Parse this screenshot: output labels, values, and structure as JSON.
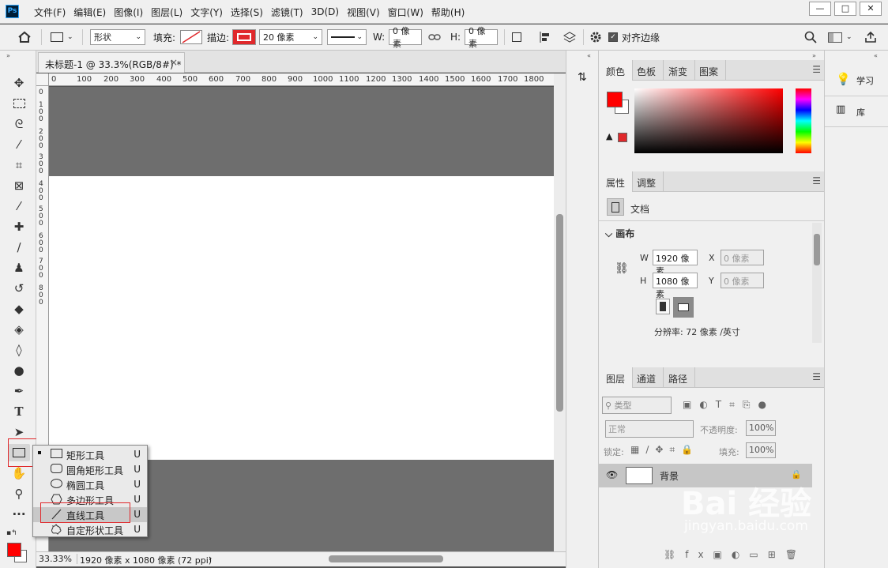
{
  "app": {
    "logo": "Ps"
  },
  "menu": [
    "文件(F)",
    "编辑(E)",
    "图像(I)",
    "图层(L)",
    "文字(Y)",
    "选择(S)",
    "滤镜(T)",
    "3D(D)",
    "视图(V)",
    "窗口(W)",
    "帮助(H)"
  ],
  "window_buttons": [
    "—",
    "□",
    "✕"
  ],
  "options": {
    "mode": "形状",
    "fill_label": "填充:",
    "stroke_label": "描边:",
    "stroke_width": "20 像素",
    "w_label": "W:",
    "w_value": "0 像素",
    "h_label": "H:",
    "h_value": "0 像素",
    "align_edges": "对齐边缘"
  },
  "document": {
    "tab_title": "未标题-1 @ 33.3%(RGB/8#) *",
    "close": "×",
    "ruler_h": [
      "0",
      "100",
      "200",
      "300",
      "400",
      "500",
      "600",
      "700",
      "800",
      "900",
      "1000",
      "1100",
      "1200",
      "1300",
      "1400",
      "1500",
      "1600",
      "1700",
      "1800"
    ],
    "ruler_v": [
      "0",
      "1\n0\n0",
      "2\n0\n0",
      "3\n0\n0",
      "4\n0\n0",
      "5\n0\n0",
      "6\n0\n0",
      "7\n0\n0",
      "8\n0\n0"
    ],
    "zoom": "33.33%",
    "doc_info": "1920 像素 x 1080 像素 (72 ppi)",
    "status_arrow": "›"
  },
  "flyout": [
    {
      "label": "矩形工具",
      "key": "U"
    },
    {
      "label": "圆角矩形工具",
      "key": "U"
    },
    {
      "label": "椭圆工具",
      "key": "U"
    },
    {
      "label": "多边形工具",
      "key": "U"
    },
    {
      "label": "直线工具",
      "key": "U"
    },
    {
      "label": "自定形状工具",
      "key": "U"
    }
  ],
  "color_panel": {
    "tabs": [
      "颜色",
      "色板",
      "渐变",
      "图案"
    ],
    "foreground": "#ff0000",
    "background": "#ffffff"
  },
  "properties_panel": {
    "tabs": [
      "属性",
      "调整"
    ],
    "doc_label": "文档",
    "section": "画布",
    "w_label": "W",
    "w_value": "1920 像素",
    "h_label": "H",
    "h_value": "1080 像素",
    "x_label": "X",
    "x_value": "0 像素",
    "y_label": "Y",
    "y_value": "0 像素",
    "resolution": "分辨率: 72 像素 /英寸"
  },
  "layers_panel": {
    "tabs": [
      "图层",
      "通道",
      "路径"
    ],
    "filter": "类型",
    "blend_mode": "正常",
    "opacity_label": "不透明度:",
    "opacity": "100%",
    "lock_label": "锁定:",
    "fill_label": "填充:",
    "fill": "100%",
    "layer_name": "背景"
  },
  "right_strip": {
    "learn": "学习",
    "library": "库"
  },
  "watermark": {
    "main": "Bai 经验",
    "sub": "jingyan.baidu.com"
  },
  "colors": {
    "accent_red": "#e0282b",
    "panel_bg": "#f0f0f0",
    "canvas_bg": "#6e6e6e"
  }
}
